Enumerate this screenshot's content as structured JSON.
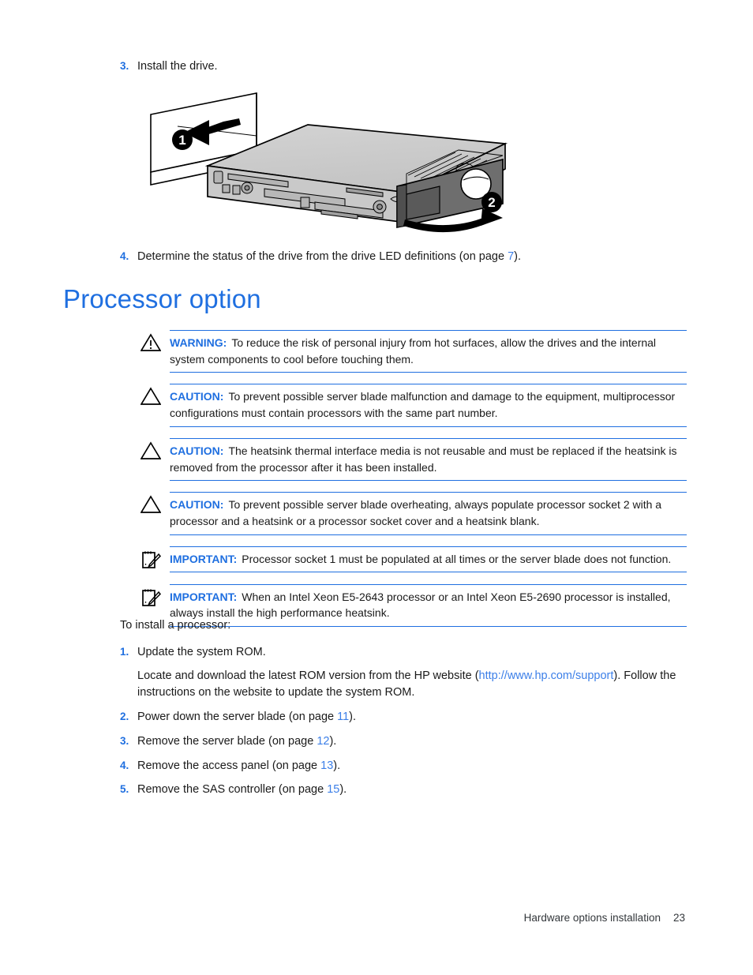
{
  "colors": {
    "accent_blue": "#1f6fe0",
    "link_blue": "#3c7fe8",
    "body_text": "#1a1a1a"
  },
  "step3": {
    "number": "3.",
    "text": "Install the drive."
  },
  "figure": {
    "callout_1": "1",
    "callout_2": "2"
  },
  "step4": {
    "number": "4.",
    "text_before": "Determine the status of the drive from the drive LED definitions (on page ",
    "page_ref": "7",
    "text_after": ")."
  },
  "heading": "Processor option",
  "admonitions": [
    {
      "icon": "warning-triangle-icon",
      "label": "WARNING:",
      "text": "To reduce the risk of personal injury from hot surfaces, allow the drives and the internal system components to cool before touching them."
    },
    {
      "icon": "caution-triangle-icon",
      "label": "CAUTION:",
      "text": "To prevent possible server blade malfunction and damage to the equipment, multiprocessor configurations must contain processors with the same part number."
    },
    {
      "icon": "caution-triangle-icon",
      "label": "CAUTION:",
      "text": "The heatsink thermal interface media is not reusable and must be replaced if the heatsink is removed from the processor after it has been installed."
    },
    {
      "icon": "caution-triangle-icon",
      "label": "CAUTION:",
      "text": "To prevent possible server blade overheating, always populate processor socket 2 with a processor and a heatsink or a processor socket cover and a heatsink blank."
    },
    {
      "icon": "important-note-icon",
      "label": "IMPORTANT:",
      "text": "Processor socket 1 must be populated at all times or the server blade does not function."
    },
    {
      "icon": "important-note-icon",
      "label": "IMPORTANT:",
      "text": "When an Intel Xeon E5-2643 processor or an Intel Xeon E5-2690 processor is installed, always install the high performance heatsink."
    }
  ],
  "procedure": {
    "lead_in": "To install a processor:",
    "items": [
      {
        "number": "1.",
        "text": "Update the system ROM.",
        "sub_before": "Locate and download the latest ROM version from the HP website (",
        "sub_link": "http://www.hp.com/support",
        "sub_after": "). Follow the instructions on the website to update the system ROM."
      },
      {
        "number": "2.",
        "text_before": "Power down the server blade (on page ",
        "page_ref": "11",
        "text_after": ")."
      },
      {
        "number": "3.",
        "text_before": "Remove the server blade (on page ",
        "page_ref": "12",
        "text_after": ")."
      },
      {
        "number": "4.",
        "text_before": "Remove the access panel (on page ",
        "page_ref": "13",
        "text_after": ")."
      },
      {
        "number": "5.",
        "text_before": "Remove the SAS controller (on page ",
        "page_ref": "15",
        "text_after": ")."
      }
    ]
  },
  "footer": {
    "title": "Hardware options installation",
    "page_number": "23"
  }
}
